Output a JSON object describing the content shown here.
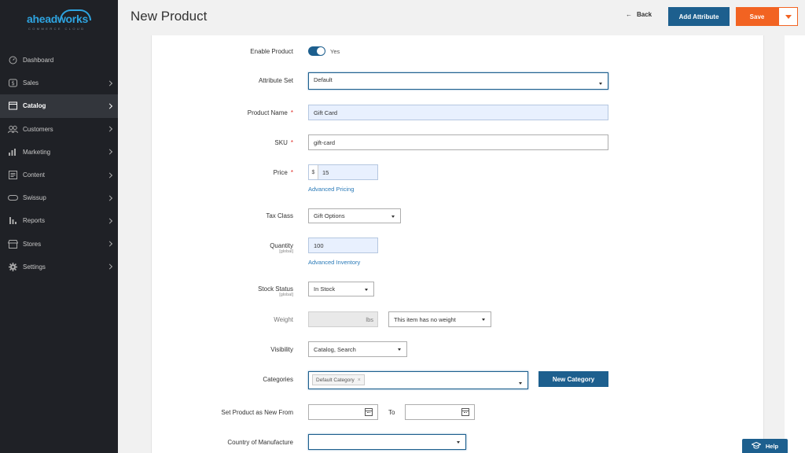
{
  "brand": {
    "logo_text": "aheadworks",
    "logo_sub": "COMMERCE CLOUD",
    "accent": "#2ea4e0"
  },
  "sidebar": {
    "items": [
      {
        "label": "Dashboard",
        "icon": "dashboard-icon"
      },
      {
        "label": "Sales",
        "icon": "dollar-icon"
      },
      {
        "label": "Catalog",
        "icon": "catalog-icon",
        "active": true
      },
      {
        "label": "Customers",
        "icon": "customers-icon"
      },
      {
        "label": "Marketing",
        "icon": "marketing-icon"
      },
      {
        "label": "Content",
        "icon": "content-icon"
      },
      {
        "label": "Swissup",
        "icon": "swissup-icon"
      },
      {
        "label": "Reports",
        "icon": "reports-icon"
      },
      {
        "label": "Stores",
        "icon": "stores-icon"
      },
      {
        "label": "Settings",
        "icon": "gear-icon"
      }
    ]
  },
  "header": {
    "title": "New Product",
    "back_label": "Back",
    "add_attribute_label": "Add Attribute",
    "save_label": "Save",
    "colors": {
      "primary": "#1d5f8e",
      "save": "#f26322"
    }
  },
  "form": {
    "enable_product": {
      "label": "Enable Product",
      "value": "Yes",
      "on": true
    },
    "attribute_set": {
      "label": "Attribute Set",
      "value": "Default"
    },
    "product_name": {
      "label": "Product Name",
      "value": "Gift Card",
      "required": "*"
    },
    "sku": {
      "label": "SKU",
      "value": "gift-card",
      "required": "*"
    },
    "price": {
      "label": "Price",
      "currency": "$",
      "value": "15",
      "required": "*",
      "link": "Advanced Pricing"
    },
    "tax_class": {
      "label": "Tax Class",
      "value": "Gift Options"
    },
    "quantity": {
      "label": "Quantity",
      "scope": "[global]",
      "value": "100",
      "link": "Advanced Inventory"
    },
    "stock_status": {
      "label": "Stock Status",
      "scope": "[global]",
      "value": "In Stock"
    },
    "weight": {
      "label": "Weight",
      "unit": "lbs",
      "value": "",
      "option": "This item has no weight"
    },
    "visibility": {
      "label": "Visibility",
      "value": "Catalog, Search"
    },
    "categories": {
      "label": "Categories",
      "chip": "Default Category",
      "chip_remove": "×",
      "new_button": "New Category"
    },
    "new_from": {
      "label": "Set Product as New From",
      "to_label": "To"
    },
    "country": {
      "label": "Country of Manufacture",
      "value": ""
    }
  },
  "help": {
    "label": "Help"
  }
}
